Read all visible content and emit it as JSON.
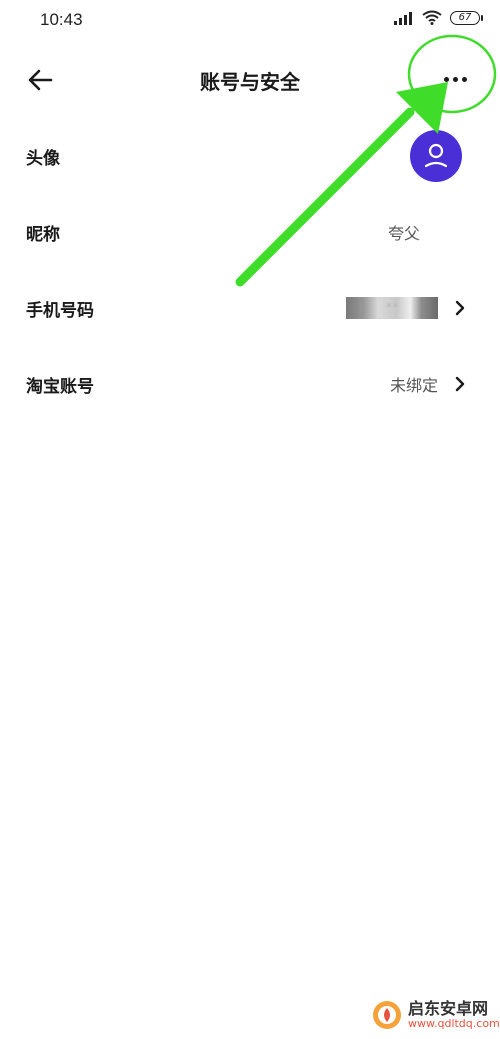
{
  "status_bar": {
    "time": "10:43",
    "battery": "67",
    "icons": [
      "signal-icon",
      "wifi-icon",
      "battery-icon"
    ]
  },
  "nav": {
    "title": "账号与安全",
    "back_icon": "back-arrow-icon",
    "more_icon": "more-dots-icon"
  },
  "settings": {
    "rows": [
      {
        "label": "头像",
        "value": ""
      },
      {
        "label": "昵称",
        "value": "夸父"
      },
      {
        "label": "手机号码",
        "value": "**"
      },
      {
        "label": "淘宝账号",
        "value": "未绑定"
      }
    ]
  },
  "colors": {
    "avatar_bg": "#4b2fd6",
    "annotation_green": "#3fdc2a",
    "watermark_accent": "#e8533f"
  },
  "watermark": {
    "name": "启东安卓网",
    "url": "www.qdltdq.com"
  }
}
